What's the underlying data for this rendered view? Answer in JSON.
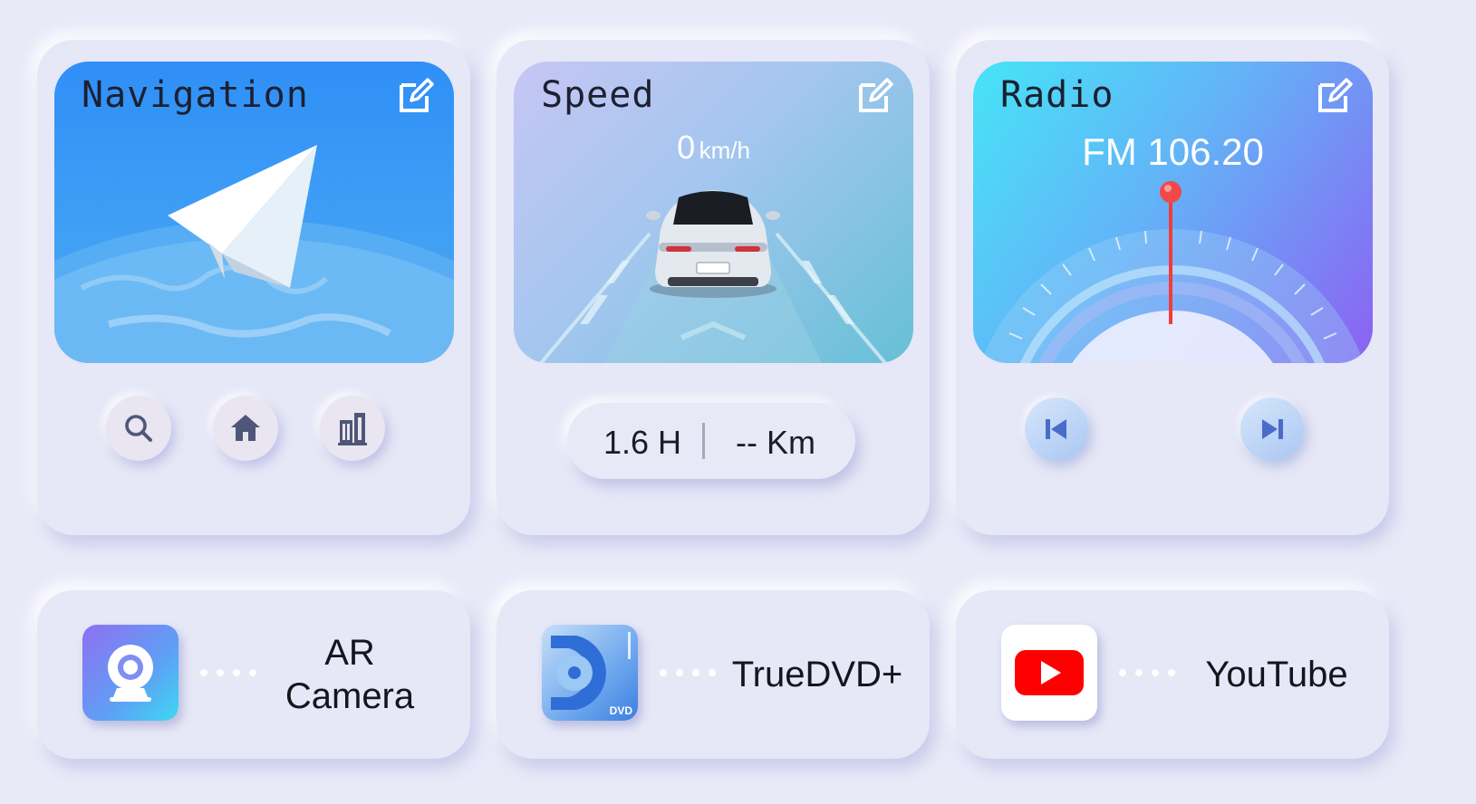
{
  "navigation": {
    "title": "Navigation",
    "buttons": [
      {
        "icon": "search-icon"
      },
      {
        "icon": "home-icon"
      },
      {
        "icon": "building-icon"
      }
    ]
  },
  "speed": {
    "title": "Speed",
    "value": "0",
    "unit": "km/h",
    "duration": "1.6 H",
    "distance": "-- Km"
  },
  "radio": {
    "title": "Radio",
    "frequency": "FM 106.20",
    "prev_icon": "skip-previous-icon",
    "next_icon": "skip-next-icon"
  },
  "apps": [
    {
      "label_line1": "AR",
      "label_line2": "Camera",
      "icon": "camera-icon"
    },
    {
      "label": "TrueDVD+",
      "icon": "dvd-icon",
      "badge": "DVD"
    },
    {
      "label": "YouTube",
      "icon": "youtube-icon"
    }
  ],
  "colors": {
    "background": "#e9eaf8",
    "accent_blue": "#3a8ef7",
    "youtube_red": "#ff0000"
  }
}
